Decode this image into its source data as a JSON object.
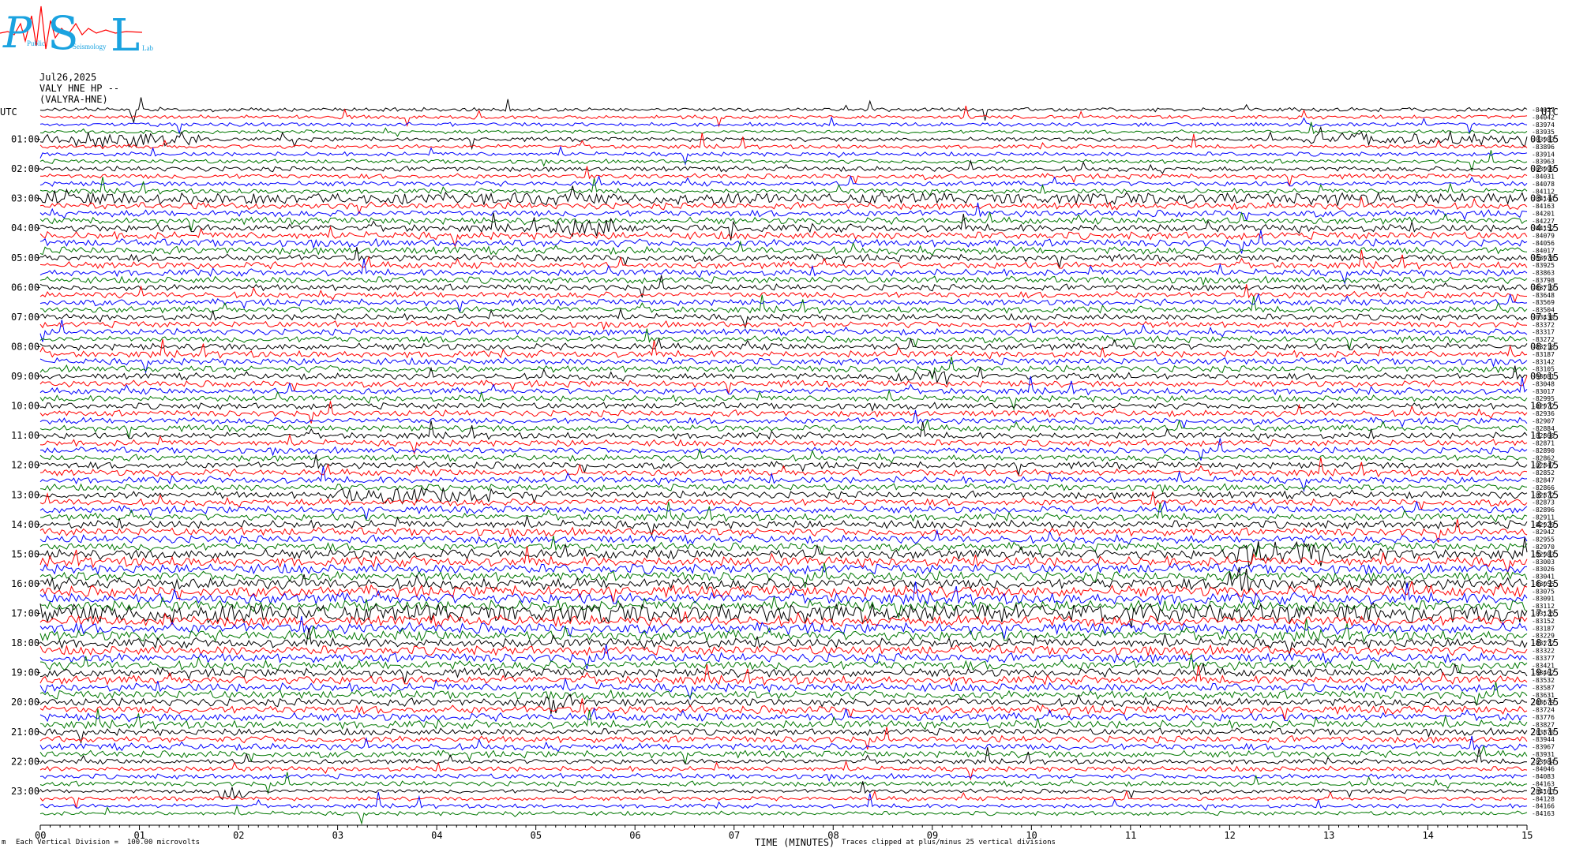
{
  "header": {
    "logo_letters": [
      "P",
      "S",
      "L"
    ],
    "logo_words": [
      "Public",
      "Seismology",
      "Lab"
    ],
    "date": "Jul26,2025",
    "channel": "VALY HNE HP --",
    "station": "(VALYRA-HNE)"
  },
  "footer": {
    "scale_note": "Each Vertical Division =  100.00 microvolts",
    "clip_note": "Traces clipped at plus/minus 25 vertical divisions",
    "corner_mark": "m"
  },
  "colors": {
    "trace_cycle": [
      "#000000",
      "#ff0000",
      "#0000ff",
      "#007700"
    ],
    "logo": "#1ba3e0",
    "logo_wave": "#ff0000",
    "background": "#ffffff"
  },
  "chart_data": {
    "type": "line",
    "title": "Jul26,2025 VALY HNE HP --",
    "xlabel": "TIME (MINUTES)",
    "ylabel": "UTC",
    "xlim": [
      0,
      15
    ],
    "x_ticks": [
      "00",
      "01",
      "02",
      "03",
      "04",
      "05",
      "06",
      "07",
      "08",
      "09",
      "10",
      "11",
      "12",
      "13",
      "14",
      "15"
    ],
    "left_axis_label": "UTC",
    "right_axis_label": "UTC",
    "left_hour_labels": [
      "01:00",
      "02:00",
      "03:00",
      "04:00",
      "05:00",
      "06:00",
      "07:00",
      "08:00",
      "09:00",
      "10:00",
      "11:00",
      "12:00",
      "13:00",
      "14:00",
      "15:00",
      "16:00",
      "17:00",
      "18:00",
      "19:00",
      "20:00",
      "21:00",
      "22:00",
      "23:00"
    ],
    "right_hour_labels": [
      "01:15",
      "02:15",
      "03:15",
      "04:15",
      "05:15",
      "06:15",
      "07:15",
      "08:15",
      "09:15",
      "10:15",
      "11:15",
      "12:15",
      "13:15",
      "14:15",
      "15:15",
      "16:15",
      "17:15",
      "18:15",
      "19:15",
      "20:15",
      "21:15",
      "22:15",
      "23:15"
    ],
    "trace_count": 96,
    "trace_offsets": [
      "-84027",
      "-84042",
      "-83974",
      "-83935",
      "-83983",
      "-83896",
      "-83914",
      "-83963",
      "-83999",
      "-84031",
      "-84078",
      "-84112",
      "-84144",
      "-84163",
      "-84201",
      "-84227",
      "-84152",
      "-84079",
      "-84056",
      "-84017",
      "-83978",
      "-83925",
      "-83863",
      "-83798",
      "-83719",
      "-83648",
      "-83569",
      "-83504",
      "-83430",
      "-83372",
      "-83317",
      "-83272",
      "-83210",
      "-83187",
      "-83142",
      "-83105",
      "-83081",
      "-83048",
      "-83017",
      "-82995",
      "-82972",
      "-82936",
      "-82907",
      "-82884",
      "-82860",
      "-82871",
      "-82890",
      "-82862",
      "-82847",
      "-82852",
      "-82847",
      "-82866",
      "-82872",
      "-82873",
      "-82896",
      "-82911",
      "-82929",
      "-82942",
      "-82955",
      "-82970",
      "-82983",
      "-83003",
      "-83026",
      "-83041",
      "-83055",
      "-83075",
      "-83091",
      "-83112",
      "-83125",
      "-83152",
      "-83187",
      "-83229",
      "-83272",
      "-83322",
      "-83377",
      "-83421",
      "-83462",
      "-83532",
      "-83587",
      "-83631",
      "-83679",
      "-83724",
      "-83776",
      "-83827",
      "-83870",
      "-83944",
      "-83967",
      "-83931",
      "-83984",
      "-84046",
      "-84083",
      "-84163",
      "-84163",
      "-84128",
      "-84166",
      "-84163"
    ],
    "noise_level_by_hour": [
      0.9,
      1.0,
      1.2,
      1.6,
      1.8,
      1.6,
      1.5,
      1.5,
      1.6,
      1.5,
      1.5,
      1.5,
      1.6,
      1.7,
      1.9,
      2.3,
      2.6,
      2.5,
      2.2,
      2.0,
      1.9,
      1.6,
      1.2,
      1.0
    ],
    "events": [
      {
        "hour": 0,
        "minute": 0.9,
        "duration": 0.15,
        "amplitude": 6
      },
      {
        "hour": 1,
        "minute": 0.0,
        "duration": 1.6,
        "amplitude": 2.5
      },
      {
        "hour": 1,
        "minute": 12.8,
        "duration": 2.2,
        "amplitude": 2.5
      },
      {
        "hour": 3,
        "minute": 0.0,
        "duration": 15.0,
        "amplitude": 1.2
      },
      {
        "hour": 4,
        "minute": 5.2,
        "duration": 0.6,
        "amplitude": 3
      },
      {
        "hour": 9,
        "minute": 8.6,
        "duration": 0.6,
        "amplitude": 2.5
      },
      {
        "hour": 13,
        "minute": 3.0,
        "duration": 1.6,
        "amplitude": 3
      },
      {
        "hour": 15,
        "minute": 12.0,
        "duration": 1.0,
        "amplitude": 5
      },
      {
        "hour": 16,
        "minute": 12.0,
        "duration": 0.3,
        "amplitude": 5
      },
      {
        "hour": 17,
        "minute": 0.0,
        "duration": 15.0,
        "amplitude": 2.0
      },
      {
        "hour": 20,
        "minute": 5.1,
        "duration": 0.3,
        "amplitude": 4
      },
      {
        "hour": 23,
        "minute": 1.8,
        "duration": 0.3,
        "amplitude": 5
      }
    ],
    "grid": false
  }
}
